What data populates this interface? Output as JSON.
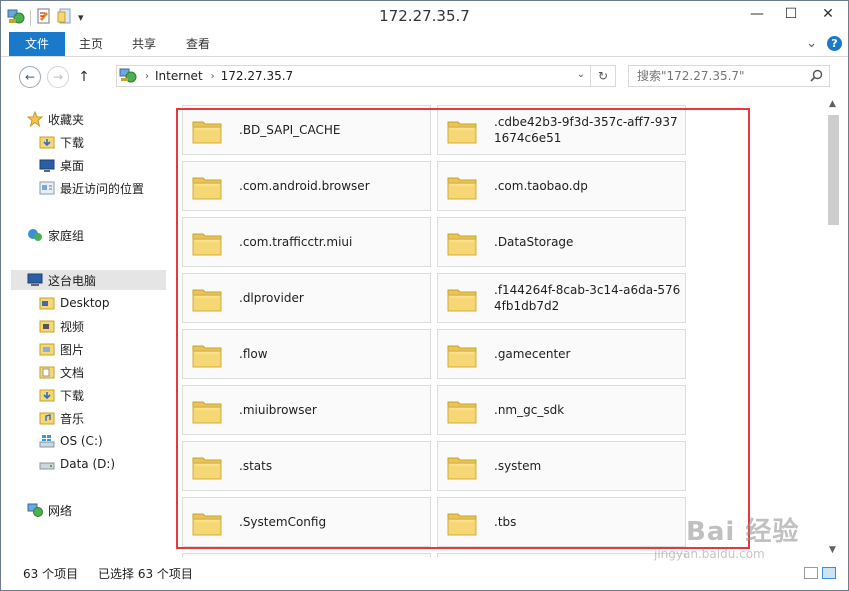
{
  "window": {
    "title": "172.27.35.7",
    "minimize_glyph": "—",
    "maximize_glyph": "☐",
    "close_glyph": "✕"
  },
  "quick_access": {
    "menu_glyph": "▾"
  },
  "ribbon": {
    "tabs": [
      "文件",
      "主页",
      "共享",
      "查看"
    ],
    "expand_glyph": "⌄",
    "help_glyph": "?"
  },
  "address": {
    "segments": [
      "Internet",
      "172.27.35.7"
    ],
    "separator": "›",
    "dropdown_glyph": "⌄",
    "refresh_glyph": "↻",
    "back_glyph": "←",
    "forward_glyph": "→",
    "up_glyph": "↑"
  },
  "search": {
    "placeholder": "搜索\"172.27.35.7\""
  },
  "nav": {
    "favorites": {
      "label": "收藏夹",
      "items": [
        "下载",
        "桌面",
        "最近访问的位置"
      ]
    },
    "homegroup": "家庭组",
    "this_pc": {
      "label": "这台电脑",
      "items": [
        "Desktop",
        "视频",
        "图片",
        "文档",
        "下载",
        "音乐",
        "OS (C:)",
        "Data (D:)"
      ]
    },
    "network": "网络"
  },
  "files": [
    ".BD_SAPI_CACHE",
    ".cdbe42b3-9f3d-357c-aff7-9371674c6e51",
    ".com.android.browser",
    ".com.taobao.dp",
    ".com.trafficctr.miui",
    ".DataStorage",
    ".dlprovider",
    ".f144264f-8cab-3c14-a6da-5764fb1db7d2",
    ".flow",
    ".gamecenter",
    ".miuibrowser",
    ".nm_gc_sdk",
    ".stats",
    ".system",
    ".SystemConfig",
    ".tbs"
  ],
  "status": {
    "count": "63 个项目",
    "selected": "已选择 63 个项目"
  },
  "watermark": {
    "main": "Bai 经验",
    "sub": "jingyan.baidu.com"
  },
  "colors": {
    "file_tab": "#1979ca",
    "highlight_border": "#e8383d",
    "folder_yellow": "#f5d776",
    "tile_bg": "#fafafa"
  }
}
